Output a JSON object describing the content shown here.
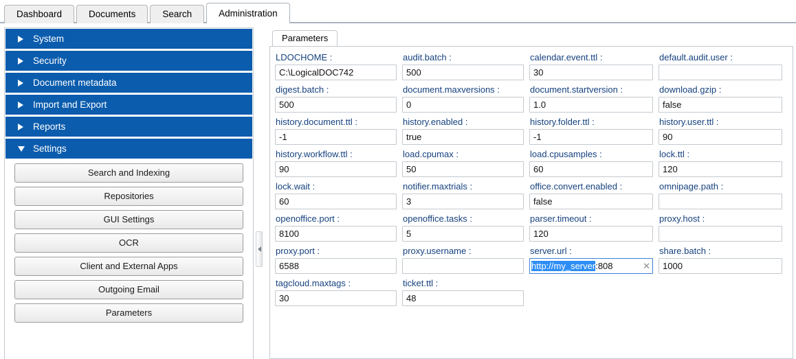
{
  "topbar": {
    "tabs": [
      {
        "label": "Dashboard",
        "active": false
      },
      {
        "label": "Documents",
        "active": false
      },
      {
        "label": "Search",
        "active": false
      },
      {
        "label": "Administration",
        "active": true
      }
    ]
  },
  "sidebar": {
    "sections": [
      {
        "label": "System",
        "expanded": false
      },
      {
        "label": "Security",
        "expanded": false
      },
      {
        "label": "Document metadata",
        "expanded": false
      },
      {
        "label": "Import and Export",
        "expanded": false
      },
      {
        "label": "Reports",
        "expanded": false
      },
      {
        "label": "Settings",
        "expanded": true
      }
    ],
    "settings_buttons": [
      {
        "label": "Search and Indexing"
      },
      {
        "label": "Repositories"
      },
      {
        "label": "GUI Settings"
      },
      {
        "label": "OCR"
      },
      {
        "label": "Client and External Apps"
      },
      {
        "label": "Outgoing Email"
      },
      {
        "label": "Parameters"
      }
    ],
    "collapse_icon": "collapse-left-arrow-icon"
  },
  "main": {
    "tab_label": "Parameters",
    "parameters": [
      {
        "label": "LDOCHOME :",
        "value": "C:\\LogicalDOC742",
        "state": "normal"
      },
      {
        "label": "audit.batch :",
        "value": "500",
        "state": "normal"
      },
      {
        "label": "calendar.event.ttl :",
        "value": "30",
        "state": "normal"
      },
      {
        "label": "default.audit.user :",
        "value": "",
        "state": "normal"
      },
      {
        "label": "digest.batch :",
        "value": "500",
        "state": "normal"
      },
      {
        "label": "document.maxversions :",
        "value": "0",
        "state": "normal"
      },
      {
        "label": "document.startversion :",
        "value": "1.0",
        "state": "normal"
      },
      {
        "label": "download.gzip :",
        "value": "false",
        "state": "normal"
      },
      {
        "label": "history.document.ttl :",
        "value": "-1",
        "state": "normal"
      },
      {
        "label": "history.enabled :",
        "value": "true",
        "state": "normal"
      },
      {
        "label": "history.folder.ttl :",
        "value": "-1",
        "state": "normal"
      },
      {
        "label": "history.user.ttl :",
        "value": "90",
        "state": "normal"
      },
      {
        "label": "history.workflow.ttl :",
        "value": "90",
        "state": "normal"
      },
      {
        "label": "load.cpumax :",
        "value": "50",
        "state": "normal"
      },
      {
        "label": "load.cpusamples :",
        "value": "60",
        "state": "normal"
      },
      {
        "label": "lock.ttl :",
        "value": "120",
        "state": "normal"
      },
      {
        "label": "lock.wait :",
        "value": "60",
        "state": "normal"
      },
      {
        "label": "notifier.maxtrials :",
        "value": "3",
        "state": "normal"
      },
      {
        "label": "office.convert.enabled :",
        "value": "false",
        "state": "normal"
      },
      {
        "label": "omnipage.path :",
        "value": "",
        "state": "normal"
      },
      {
        "label": "openoffice.port :",
        "value": "8100",
        "state": "normal"
      },
      {
        "label": "openoffice.tasks :",
        "value": "5",
        "state": "normal"
      },
      {
        "label": "parser.timeout :",
        "value": "120",
        "state": "normal"
      },
      {
        "label": "proxy.host :",
        "value": "",
        "state": "normal"
      },
      {
        "label": "proxy.port :",
        "value": "6588",
        "state": "normal"
      },
      {
        "label": "proxy.username :",
        "value": "",
        "state": "normal"
      },
      {
        "label": "server.url :",
        "value": "http://my_server:808",
        "state": "focused",
        "selected_text": "http://my_server",
        "trailing_text": ":808",
        "clear_icon": "clear-x-icon"
      },
      {
        "label": "share.batch :",
        "value": "1000",
        "state": "normal"
      },
      {
        "label": "tagcloud.maxtags :",
        "value": "30",
        "state": "normal"
      },
      {
        "label": "ticket.ttl :",
        "value": "48",
        "state": "normal"
      }
    ]
  },
  "colors": {
    "accent_blue": "#0b5cad",
    "label_blue": "#15417e",
    "selection_blue": "#2d8ef5",
    "focus_border": "#3a7fd5",
    "field_border": "#c3c9cf"
  }
}
